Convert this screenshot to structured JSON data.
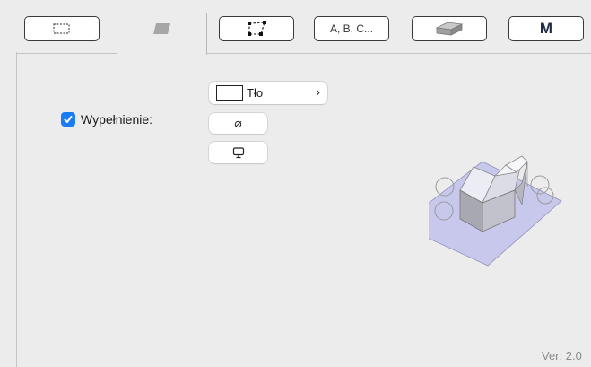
{
  "tabs": [
    {
      "id": "frame",
      "icon": "dashed-frame-icon"
    },
    {
      "id": "fill",
      "icon": "fill-parallelogram-icon",
      "active": true
    },
    {
      "id": "corners",
      "icon": "corner-points-icon"
    },
    {
      "id": "labels",
      "label": "A, B, C..."
    },
    {
      "id": "3d",
      "icon": "3d-slab-icon"
    },
    {
      "id": "materials",
      "label": "M"
    }
  ],
  "fill": {
    "checkbox_label": "Wypełnienie:",
    "checked": true,
    "background_label": "Tło",
    "none_symbol": "⌀"
  },
  "footer": {
    "version": "Ver: 2.0"
  }
}
